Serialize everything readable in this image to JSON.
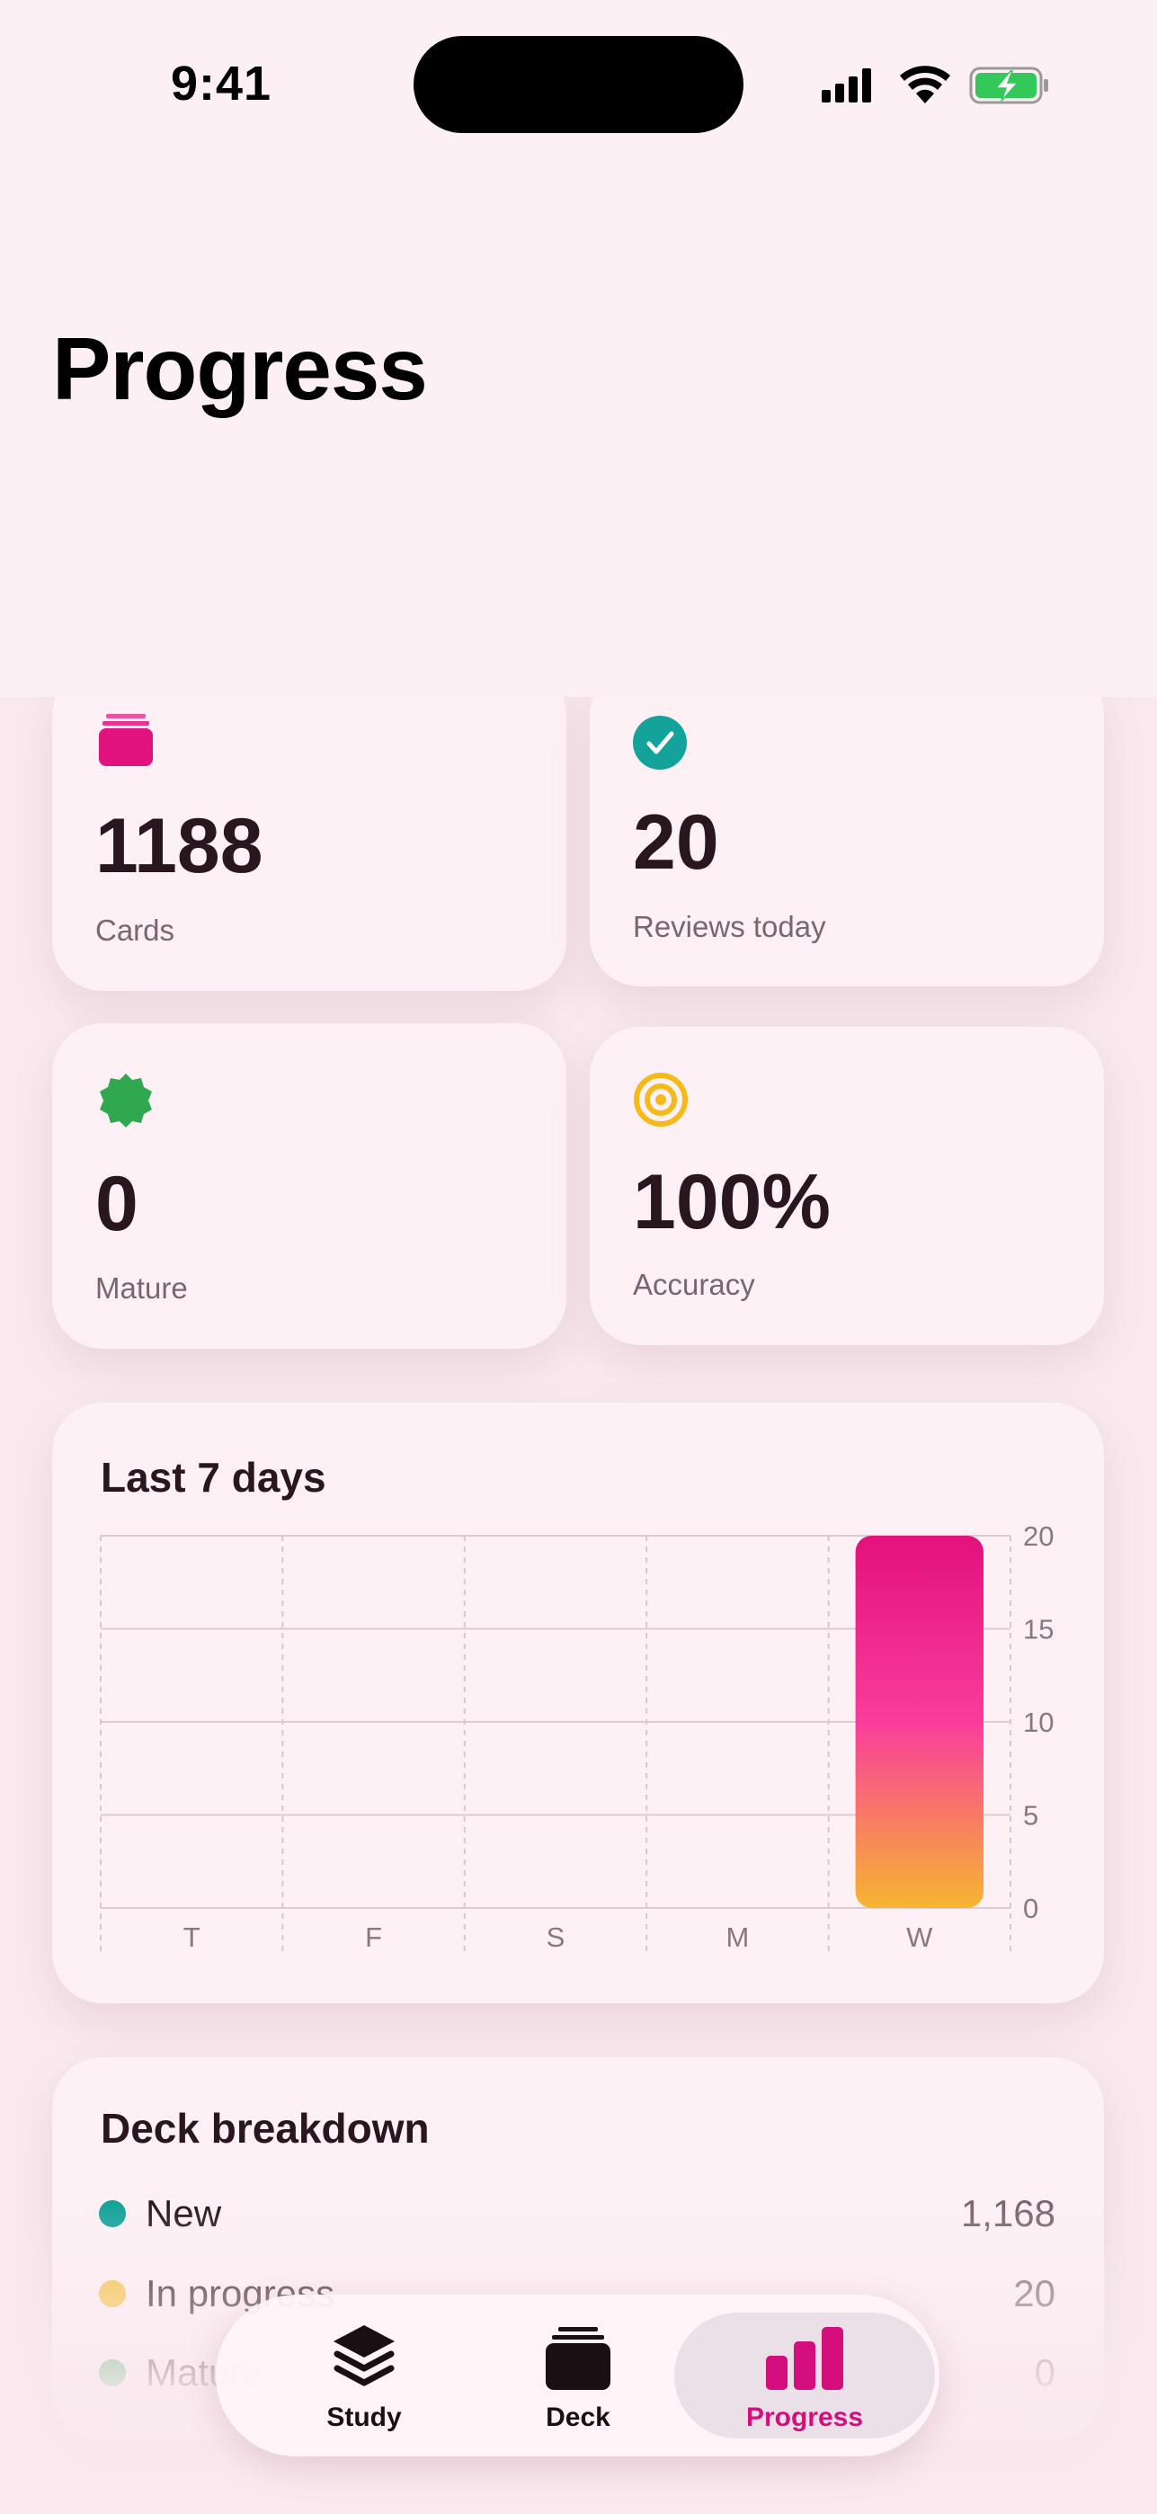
{
  "status_bar": {
    "time": "9:41"
  },
  "page": {
    "title": "Progress"
  },
  "stats": [
    {
      "value": "1188",
      "label": "Cards",
      "icon": "cards-icon",
      "color": "#e0137f"
    },
    {
      "value": "20",
      "label": "Reviews today",
      "icon": "checkmark-circle-icon",
      "color": "#14a39a"
    },
    {
      "value": "0",
      "label": "Mature",
      "icon": "seal-icon",
      "color": "#2fa84f"
    },
    {
      "value": "100%",
      "label": "Accuracy",
      "icon": "target-icon",
      "color": "#f6b91a"
    }
  ],
  "chart_section": {
    "title": "Last 7 days"
  },
  "chart_data": {
    "type": "bar",
    "categories": [
      "T",
      "F",
      "S",
      "M",
      "W"
    ],
    "values": [
      0,
      0,
      0,
      0,
      20
    ],
    "ylim": [
      0,
      20
    ],
    "yticks": [
      "0",
      "5",
      "10",
      "15",
      "20"
    ],
    "y_axis_position": "right",
    "grid": true,
    "bar_gradient": [
      "#e3117d",
      "#f93d9c",
      "#f7b531"
    ]
  },
  "breakdown": {
    "title": "Deck breakdown",
    "rows": [
      {
        "label": "New",
        "value": "1,168",
        "color": "#14a39a"
      },
      {
        "label": "In progress",
        "value": "20",
        "color": "#f6c23b"
      },
      {
        "label": "Mature",
        "value": "0",
        "color": "#2fa84f"
      }
    ]
  },
  "tabbar": {
    "tabs": [
      {
        "label": "Study",
        "icon": "stack-icon",
        "active": false
      },
      {
        "label": "Deck",
        "icon": "deck-icon",
        "active": false
      },
      {
        "label": "Progress",
        "icon": "bar-chart-icon",
        "active": true
      }
    ]
  }
}
